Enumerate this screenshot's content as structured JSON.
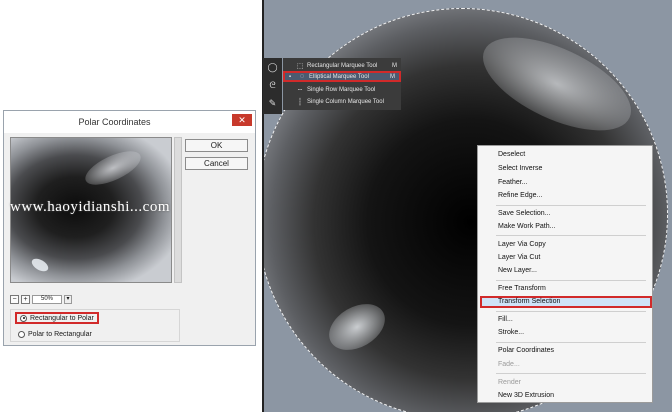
{
  "dialog": {
    "title": "Polar Coordinates",
    "close_label": "✕",
    "ok_label": "OK",
    "cancel_label": "Cancel",
    "zoom_out_label": "−",
    "zoom_in_label": "+",
    "zoom_value": "50%",
    "options": [
      {
        "label": "Rectangular to Polar",
        "selected": true
      },
      {
        "label": "Polar to Rectangular",
        "selected": false
      }
    ]
  },
  "tool_flyout": {
    "items": [
      {
        "label": "Rectangular Marquee Tool",
        "shortcut": "M",
        "selected": false,
        "icon": "rect-marquee-icon"
      },
      {
        "label": "Elliptical Marquee Tool",
        "shortcut": "M",
        "selected": true,
        "icon": "ellipse-marquee-icon"
      },
      {
        "label": "Single Row Marquee Tool",
        "shortcut": "",
        "selected": false,
        "icon": "row-marquee-icon"
      },
      {
        "label": "Single Column Marquee Tool",
        "shortcut": "",
        "selected": false,
        "icon": "column-marquee-icon"
      }
    ],
    "selected_marker": "▪"
  },
  "context_menu": {
    "items": [
      {
        "label": "Deselect",
        "enabled": true
      },
      {
        "label": "Select Inverse",
        "enabled": true
      },
      {
        "label": "Feather...",
        "enabled": true
      },
      {
        "label": "Refine Edge...",
        "enabled": true
      },
      {
        "label": "Save Selection...",
        "enabled": true
      },
      {
        "label": "Make Work Path...",
        "enabled": true
      },
      {
        "label": "Layer Via Copy",
        "enabled": true
      },
      {
        "label": "Layer Via Cut",
        "enabled": true
      },
      {
        "label": "New Layer...",
        "enabled": true
      },
      {
        "label": "Free Transform",
        "enabled": true
      },
      {
        "label": "Transform Selection",
        "enabled": true,
        "highlighted": true
      },
      {
        "label": "Fill...",
        "enabled": true
      },
      {
        "label": "Stroke...",
        "enabled": true
      },
      {
        "label": "Polar Coordinates",
        "enabled": true
      },
      {
        "label": "Fade...",
        "enabled": false
      },
      {
        "label": "Render",
        "enabled": false
      },
      {
        "label": "New 3D Extrusion",
        "enabled": true
      }
    ]
  },
  "watermark": "www.haoyidianshi...com",
  "colors": {
    "highlight_border": "#d12a2a",
    "canvas_bg": "#8c96a3",
    "menu_highlight": "#cfe3f7"
  }
}
